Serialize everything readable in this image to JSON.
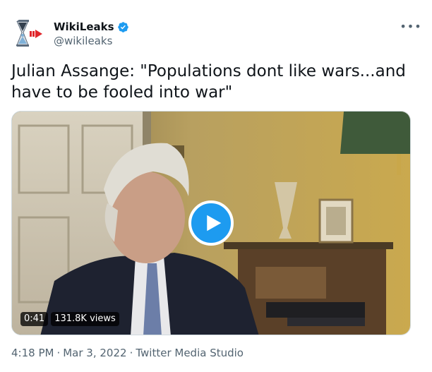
{
  "account": {
    "name": "WikiLeaks",
    "handle": "@wikileaks"
  },
  "tweet": {
    "text": "Julian Assange: \"Populations dont like wars...and have to be fooled into war\""
  },
  "video": {
    "duration": "0:41",
    "views": "131.8K views"
  },
  "footer": {
    "time": "4:18 PM",
    "separator1": "·",
    "date": "Mar 3, 2022",
    "separator2": "·",
    "source": "Twitter Media Studio"
  },
  "icons": {
    "avatar": "wikileaks-hourglass-logo-icon",
    "verified": "verified-badge-icon",
    "more": "more-options-icon",
    "play": "play-icon"
  },
  "colors": {
    "accent": "#1d9bf0",
    "text": "#0f1419",
    "secondary": "#536471"
  }
}
